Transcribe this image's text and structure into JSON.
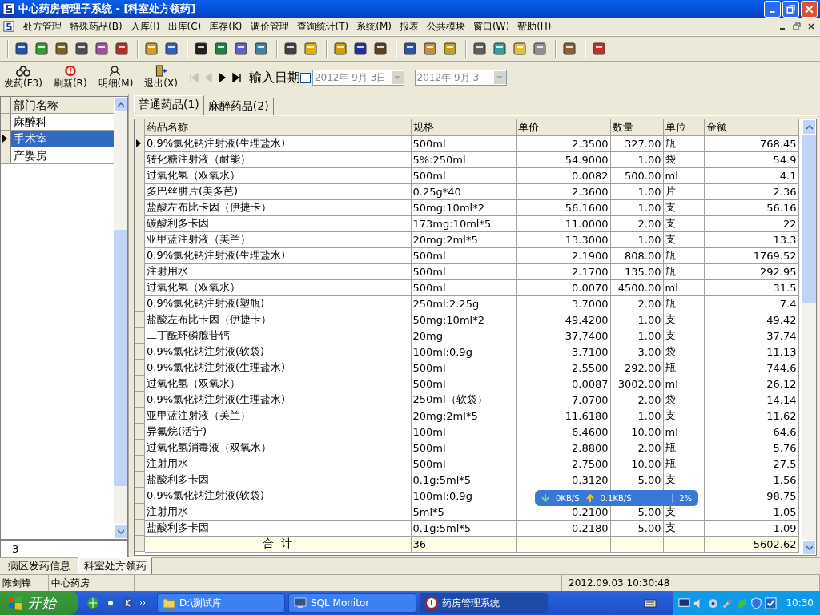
{
  "window": {
    "title": "中心药房管理子系统 - [科室处方领药]"
  },
  "menu": [
    "处方管理",
    "特殊药品(B)",
    "入库(I)",
    "出库(C)",
    "库存(K)",
    "调价管理",
    "查询统计(T)",
    "系统(M)",
    "报表",
    "公共模块",
    "窗口(W)",
    "帮助(H)"
  ],
  "actions": [
    {
      "kind": "dispense",
      "label": "发药(F3)"
    },
    {
      "kind": "refresh",
      "label": "刷新(R)"
    },
    {
      "kind": "detail",
      "label": "明细(M)"
    },
    {
      "kind": "exit",
      "label": "退出(X)"
    }
  ],
  "navigator": [
    {
      "kind": "first",
      "disabled": true
    },
    {
      "kind": "prev",
      "disabled": true
    },
    {
      "kind": "next",
      "disabled": false
    },
    {
      "kind": "last",
      "disabled": false
    }
  ],
  "date_filter": {
    "label": "输入日期",
    "checked": false,
    "from": "2012年 9月 3日",
    "separator": "--",
    "to": "2012年 9月 3"
  },
  "departments": {
    "column": "部门名称",
    "items": [
      {
        "name": "麻醉科",
        "selected": false
      },
      {
        "name": "手术室",
        "selected": true
      },
      {
        "name": "产婴房",
        "selected": false
      }
    ],
    "count": "3"
  },
  "tabs": [
    {
      "label": "普通药品(1)",
      "selected": true
    },
    {
      "label": "麻醉药品(2)",
      "selected": false
    }
  ],
  "table": {
    "columns": [
      "药品名称",
      "规格",
      "单价",
      "数量",
      "单位",
      "金额"
    ],
    "rows": [
      {
        "selected": true,
        "name": "0.9%氯化钠注射液(生理盐水)",
        "spec": "500ml",
        "price": "2.3500",
        "qty": "327.00",
        "unit": "瓶",
        "amount": "768.45"
      },
      {
        "selected": false,
        "name": "转化糖注射液（耐能）",
        "spec": "5%:250ml",
        "price": "54.9000",
        "qty": "1.00",
        "unit": "袋",
        "amount": "54.9"
      },
      {
        "selected": false,
        "name": "过氧化氢（双氧水）",
        "spec": "500ml",
        "price": "0.0082",
        "qty": "500.00",
        "unit": "ml",
        "amount": "4.1"
      },
      {
        "selected": false,
        "name": "多巴丝肼片(美多芭)",
        "spec": "0.25g*40",
        "price": "2.3600",
        "qty": "1.00",
        "unit": "片",
        "amount": "2.36"
      },
      {
        "selected": false,
        "name": "盐酸左布比卡因（伊捷卡）",
        "spec": "50mg:10ml*2",
        "price": "56.1600",
        "qty": "1.00",
        "unit": "支",
        "amount": "56.16"
      },
      {
        "selected": false,
        "name": "碳酸利多卡因",
        "spec": "173mg:10ml*5",
        "price": "11.0000",
        "qty": "2.00",
        "unit": "支",
        "amount": "22"
      },
      {
        "selected": false,
        "name": "亚甲蓝注射液（美兰）",
        "spec": "20mg:2ml*5",
        "price": "13.3000",
        "qty": "1.00",
        "unit": "支",
        "amount": "13.3"
      },
      {
        "selected": false,
        "name": "0.9%氯化钠注射液(生理盐水)",
        "spec": "500ml",
        "price": "2.1900",
        "qty": "808.00",
        "unit": "瓶",
        "amount": "1769.52"
      },
      {
        "selected": false,
        "name": "注射用水",
        "spec": "500ml",
        "price": "2.1700",
        "qty": "135.00",
        "unit": "瓶",
        "amount": "292.95"
      },
      {
        "selected": false,
        "name": "过氧化氢（双氧水）",
        "spec": "500ml",
        "price": "0.0070",
        "qty": "4500.00",
        "unit": "ml",
        "amount": "31.5"
      },
      {
        "selected": false,
        "name": "0.9%氯化钠注射液(塑瓶)",
        "spec": "250ml:2.25g",
        "price": "3.7000",
        "qty": "2.00",
        "unit": "瓶",
        "amount": "7.4"
      },
      {
        "selected": false,
        "name": "盐酸左布比卡因（伊捷卡）",
        "spec": "50mg:10ml*2",
        "price": "49.4200",
        "qty": "1.00",
        "unit": "支",
        "amount": "49.42"
      },
      {
        "selected": false,
        "name": "二丁酰环磷腺苷钙",
        "spec": "20mg",
        "price": "37.7400",
        "qty": "1.00",
        "unit": "支",
        "amount": "37.74"
      },
      {
        "selected": false,
        "name": "0.9%氯化钠注射液(软袋)",
        "spec": "100ml:0.9g",
        "price": "3.7100",
        "qty": "3.00",
        "unit": "袋",
        "amount": "11.13"
      },
      {
        "selected": false,
        "name": "0.9%氯化钠注射液(生理盐水)",
        "spec": "500ml",
        "price": "2.5500",
        "qty": "292.00",
        "unit": "瓶",
        "amount": "744.6"
      },
      {
        "selected": false,
        "name": "过氧化氢（双氧水）",
        "spec": "500ml",
        "price": "0.0087",
        "qty": "3002.00",
        "unit": "ml",
        "amount": "26.12"
      },
      {
        "selected": false,
        "name": "0.9%氯化钠注射液(生理盐水)",
        "spec": "250ml（软袋）",
        "price": "7.0700",
        "qty": "2.00",
        "unit": "袋",
        "amount": "14.14"
      },
      {
        "selected": false,
        "name": "亚甲蓝注射液（美兰）",
        "spec": "20mg:2ml*5",
        "price": "11.6180",
        "qty": "1.00",
        "unit": "支",
        "amount": "11.62"
      },
      {
        "selected": false,
        "name": "异氟烷(活宁)",
        "spec": "100ml",
        "price": "6.4600",
        "qty": "10.00",
        "unit": "ml",
        "amount": "64.6"
      },
      {
        "selected": false,
        "name": "过氧化氢消毒液（双氧水）",
        "spec": "500ml",
        "price": "2.8800",
        "qty": "2.00",
        "unit": "瓶",
        "amount": "5.76"
      },
      {
        "selected": false,
        "name": "注射用水",
        "spec": "500ml",
        "price": "2.7500",
        "qty": "10.00",
        "unit": "瓶",
        "amount": "27.5"
      },
      {
        "selected": false,
        "name": "盐酸利多卡因",
        "spec": "0.1g:5ml*5",
        "price": "0.3120",
        "qty": "5.00",
        "unit": "支",
        "amount": "1.56"
      },
      {
        "selected": false,
        "name": "0.9%氯化钠注射液(软袋)",
        "spec": "100ml:0.9g",
        "amount": "98.75"
      },
      {
        "selected": false,
        "name": "注射用水",
        "spec": "5ml*5",
        "price": "0.2100",
        "qty": "5.00",
        "unit": "支",
        "amount": "1.05"
      },
      {
        "selected": false,
        "name": "盐酸利多卡因",
        "spec": "0.1g:5ml*5",
        "price": "0.2180",
        "qty": "5.00",
        "unit": "支",
        "amount": "1.09"
      }
    ],
    "total": {
      "label": "合  计",
      "count": "36",
      "amount": "5602.62"
    }
  },
  "net_meter": {
    "down": "0KB/S",
    "up": "0.1KB/S",
    "percent": "2%"
  },
  "bottom_tabs": [
    {
      "label": "病区发药信息",
      "selected": false
    },
    {
      "label": "科室处方领药",
      "selected": true
    }
  ],
  "status_bar": {
    "user": "陈剑锋",
    "location": "中心药房",
    "datetime": "2012.09.03 10:30:48"
  },
  "taskbar": {
    "start": "开始",
    "tasks": [
      {
        "kind": "folder",
        "label": "D:\\测试库",
        "selected": false
      },
      {
        "kind": "monitor",
        "label": "SQL Monitor",
        "selected": false
      },
      {
        "kind": "app",
        "label": "药房管理系统",
        "selected": true
      }
    ],
    "clock": "10:30"
  }
}
